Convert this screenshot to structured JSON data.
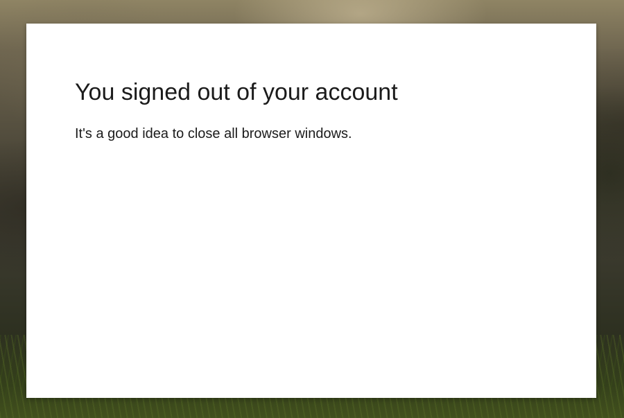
{
  "dialog": {
    "title": "You signed out of your account",
    "message": "It's a good idea to close all browser windows."
  },
  "colors": {
    "dialog_background": "#ffffff",
    "text": "#1b1b1b"
  }
}
